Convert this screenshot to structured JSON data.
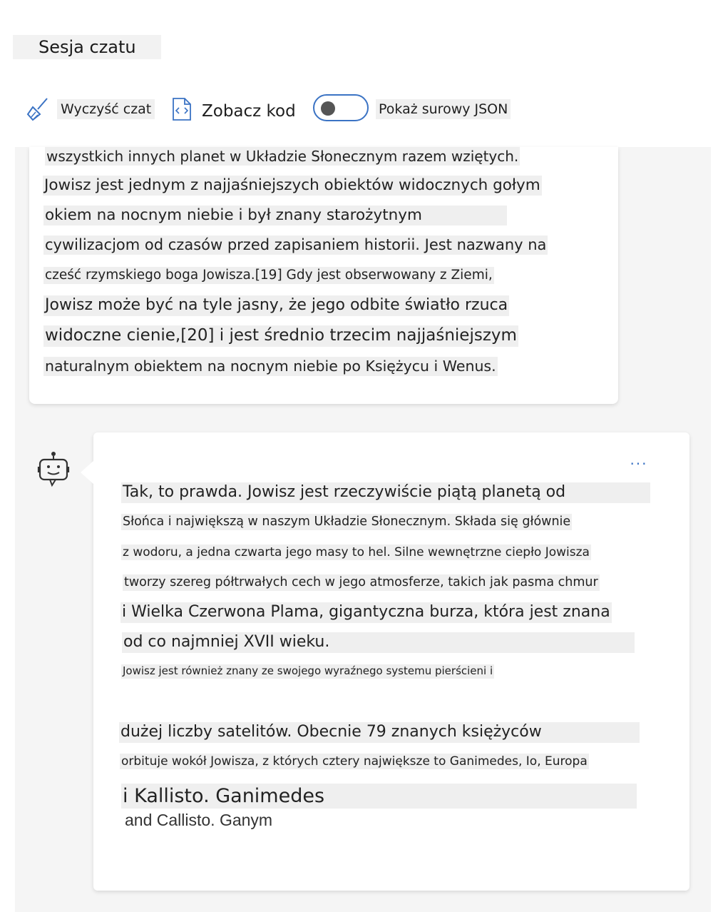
{
  "header": {
    "title": "Sesja czatu"
  },
  "toolbar": {
    "clear_label": "Wyczyść czat",
    "code_label": "Zobacz kod",
    "json_label": "Pokaż surowy JSON",
    "json_toggle_on": false,
    "accent": "#3b73c4"
  },
  "user_message": {
    "lines": [
      "wszystkich innych planet w Układzie Słonecznym razem wziętych.",
      "Jowisz jest jednym z najjaśniejszych obiektów widocznych gołym",
      "okiem na nocnym niebie i był znany starożytnym",
      "cywilizacjom od czasów przed zapisaniem historii. Jest nazwany na",
      "cześć rzymskiego boga Jowisza.[19] Gdy jest obserwowany z Ziemi,",
      "Jowisz może być na tyle jasny, że jego odbite światło rzuca",
      "widoczne cienie,[20] i jest średnio trzecim najjaśniejszym",
      "naturalnym obiektem na nocnym niebie po Księżycu i Wenus."
    ]
  },
  "bot_message": {
    "more_label": "...",
    "lines": [
      "Tak, to prawda. Jowisz jest rzeczywiście piątą planetą od",
      "Słońca i największą w naszym Układzie Słonecznym. Składa się głównie",
      "z wodoru, a jedna czwarta jego masy to hel. Silne wewnętrzne ciepło Jowisza",
      "tworzy szereg półtrwałych cech w jego atmosferze, takich jak pasma chmur",
      "i Wielka Czerwona Plama, gigantyczna burza, która jest znana",
      "od co najmniej XVII wieku.",
      "Jowisz jest również znany ze swojego wyraźnego systemu pierścieni i",
      "dużej liczby satelitów. Obecnie 79 znanych księżyców",
      "orbituje wokół Jowisza, z których cztery największe to Ganimedes, Io, Europa",
      "i Kallisto. Ganimedes"
    ],
    "trailing_text": "and Callisto. Ganym"
  }
}
